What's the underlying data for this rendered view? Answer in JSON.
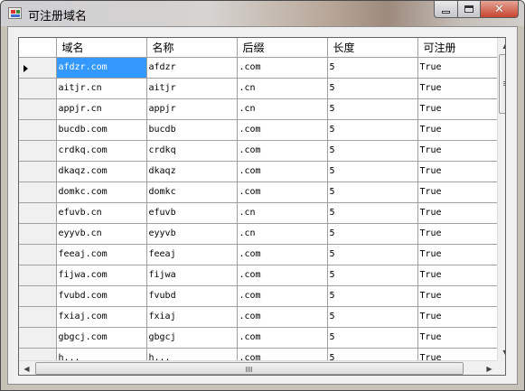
{
  "window": {
    "title": "可注册域名",
    "buttons": {
      "minimize": "minimize",
      "maximize": "maximize",
      "close": "✕"
    }
  },
  "grid": {
    "columns": [
      "域名",
      "名称",
      "后缀",
      "长度",
      "可注册"
    ],
    "selected_row": 0,
    "rows": [
      [
        "afdzr.com",
        "afdzr",
        ".com",
        "5",
        "True"
      ],
      [
        "aitjr.cn",
        "aitjr",
        ".cn",
        "5",
        "True"
      ],
      [
        "appjr.cn",
        "appjr",
        ".cn",
        "5",
        "True"
      ],
      [
        "bucdb.com",
        "bucdb",
        ".com",
        "5",
        "True"
      ],
      [
        "crdkq.com",
        "crdkq",
        ".com",
        "5",
        "True"
      ],
      [
        "dkaqz.com",
        "dkaqz",
        ".com",
        "5",
        "True"
      ],
      [
        "domkc.com",
        "domkc",
        ".com",
        "5",
        "True"
      ],
      [
        "efuvb.cn",
        "efuvb",
        ".cn",
        "5",
        "True"
      ],
      [
        "eyyvb.cn",
        "eyyvb",
        ".cn",
        "5",
        "True"
      ],
      [
        "feeaj.com",
        "feeaj",
        ".com",
        "5",
        "True"
      ],
      [
        "fijwa.com",
        "fijwa",
        ".com",
        "5",
        "True"
      ],
      [
        "fvubd.com",
        "fvubd",
        ".com",
        "5",
        "True"
      ],
      [
        "fxiaj.com",
        "fxiaj",
        ".com",
        "5",
        "True"
      ],
      [
        "gbgcj.com",
        "gbgcj",
        ".com",
        "5",
        "True"
      ],
      [
        "h...",
        "h...",
        ".com",
        "5",
        "True"
      ]
    ]
  },
  "colors": {
    "selection": "#3399ff",
    "grid_line": "#a0a0a0",
    "row_header": "#f0f0f0"
  }
}
